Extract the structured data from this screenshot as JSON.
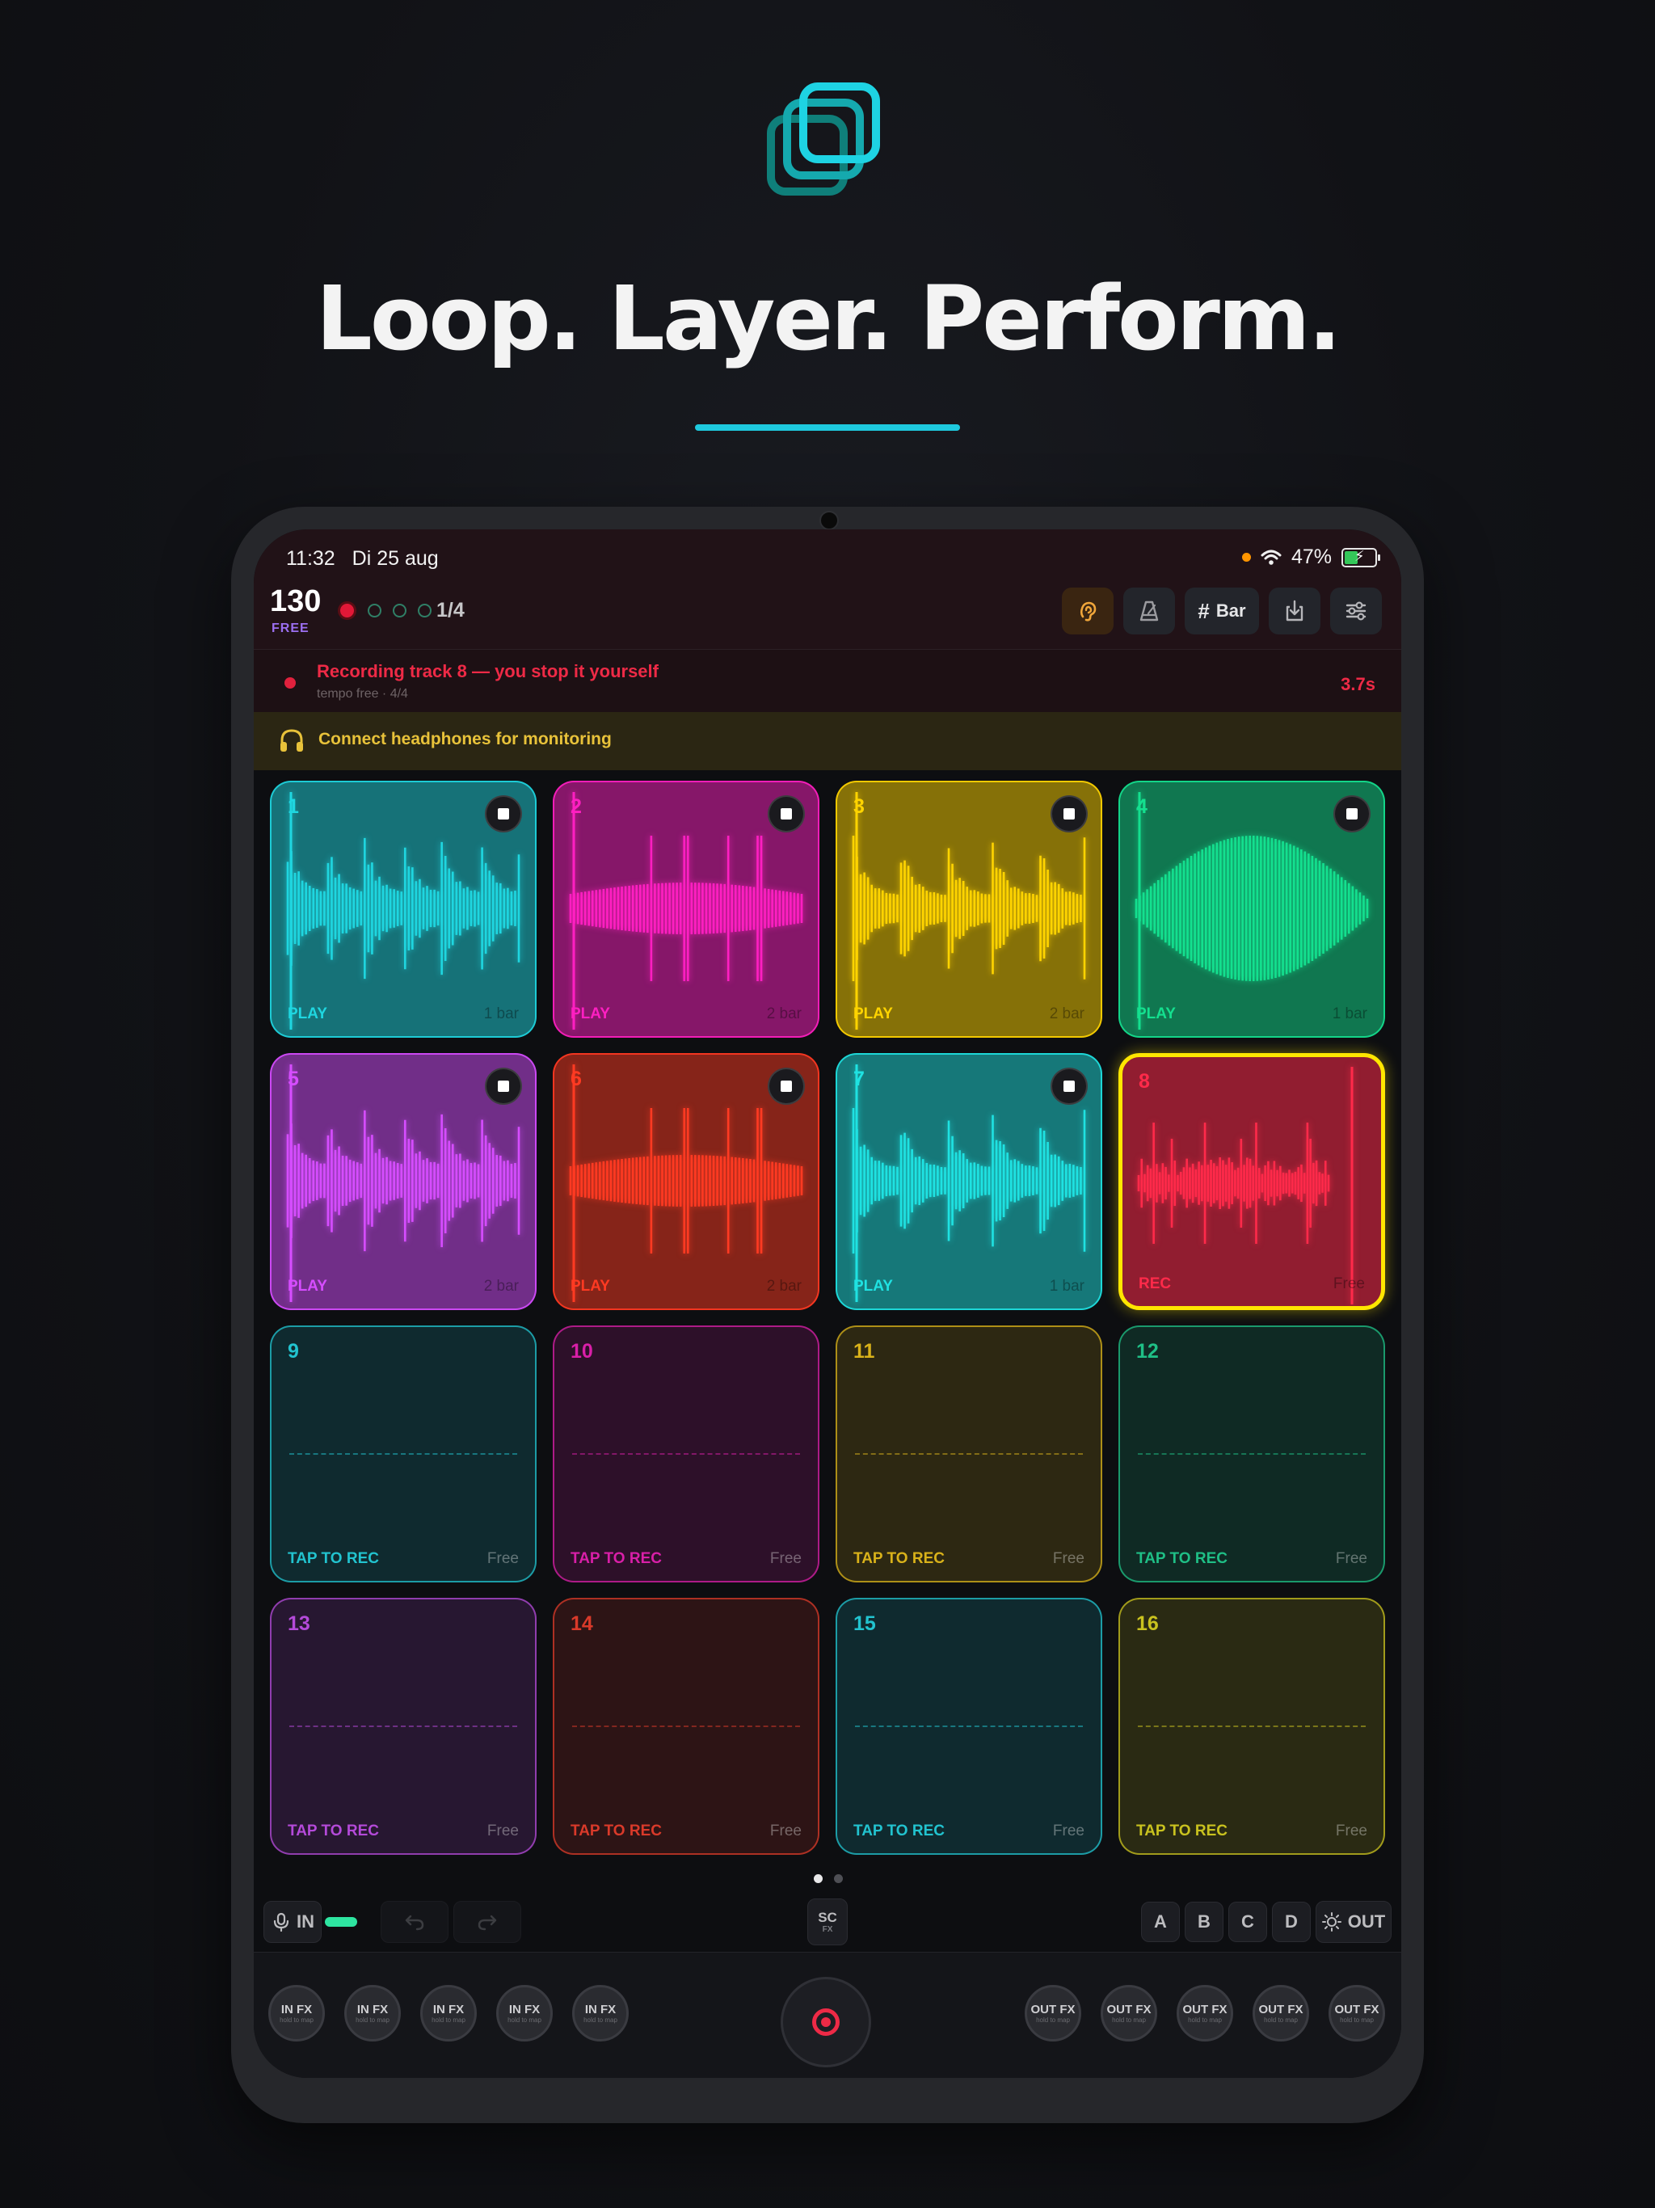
{
  "hero": {
    "headline": "Loop. Layer. Perform.",
    "accent_color": "#1ec9de",
    "logo_icon": "stacked-squares-logo"
  },
  "status_bar": {
    "time": "11:32",
    "date": "Di 25 aug",
    "battery": "47%",
    "icons": [
      "orange-dot",
      "wifi-icon",
      "battery-charging-icon"
    ]
  },
  "toolbar": {
    "bpm": "130",
    "tempo_mode": "FREE",
    "beat_position": "1/4",
    "grid_label": "Bar",
    "icons": [
      "ear-monitor-icon",
      "metronome-icon",
      "grid-icon",
      "import-icon",
      "mixer-settings-icon"
    ]
  },
  "recording_banner": {
    "title": "Recording track 8 — you stop it yourself",
    "subtitle": "tempo free · 4/4",
    "elapsed": "3.7s"
  },
  "headphone_banner": {
    "text": "Connect headphones for monitoring",
    "icon": "headphones-icon"
  },
  "pads": [
    {
      "num": "1",
      "status": "PLAY",
      "length": "1 bar",
      "color": "#1fd6e0",
      "state": "play",
      "wave": "burst"
    },
    {
      "num": "2",
      "status": "PLAY",
      "length": "2 bar",
      "color": "#ff1fc2",
      "state": "play",
      "wave": "swell"
    },
    {
      "num": "3",
      "status": "PLAY",
      "length": "2 bar",
      "color": "#ffd400",
      "state": "play",
      "wave": "decay"
    },
    {
      "num": "4",
      "status": "PLAY",
      "length": "1 bar",
      "color": "#14e08f",
      "state": "play",
      "wave": "sine"
    },
    {
      "num": "5",
      "status": "PLAY",
      "length": "2 bar",
      "color": "#d64dff",
      "state": "play",
      "wave": "burst"
    },
    {
      "num": "6",
      "status": "PLAY",
      "length": "2 bar",
      "color": "#ff3a22",
      "state": "play",
      "wave": "swell"
    },
    {
      "num": "7",
      "status": "PLAY",
      "length": "1 bar",
      "color": "#1fe2e2",
      "state": "play",
      "wave": "decay"
    },
    {
      "num": "8",
      "status": "REC",
      "length": "Free",
      "color": "#ff2a4a",
      "state": "rec",
      "wave": "noise"
    },
    {
      "num": "9",
      "status": "TAP TO REC",
      "length": "Free",
      "color": "#22c3cf",
      "state": "empty"
    },
    {
      "num": "10",
      "status": "TAP TO REC",
      "length": "Free",
      "color": "#d91fa8",
      "state": "empty"
    },
    {
      "num": "11",
      "status": "TAP TO REC",
      "length": "Free",
      "color": "#d9b21a",
      "state": "empty"
    },
    {
      "num": "12",
      "status": "TAP TO REC",
      "length": "Free",
      "color": "#1fbf86",
      "state": "empty"
    },
    {
      "num": "13",
      "status": "TAP TO REC",
      "length": "Free",
      "color": "#b44ad9",
      "state": "empty"
    },
    {
      "num": "14",
      "status": "TAP TO REC",
      "length": "Free",
      "color": "#d93a2a",
      "state": "empty"
    },
    {
      "num": "15",
      "status": "TAP TO REC",
      "length": "Free",
      "color": "#22c3cf",
      "state": "empty"
    },
    {
      "num": "16",
      "status": "TAP TO REC",
      "length": "Free",
      "color": "#c9c21f",
      "state": "empty"
    }
  ],
  "pager": {
    "pages": 2,
    "current": 1
  },
  "controls": {
    "input_label": "IN",
    "sc_label": "SC",
    "sc_sub": "FX",
    "scenes": [
      "A",
      "B",
      "C",
      "D"
    ],
    "output_label": "OUT",
    "icons": [
      "mic-icon",
      "undo-icon",
      "redo-icon",
      "brightness-icon"
    ]
  },
  "fx": {
    "in_knobs": [
      {
        "label": "IN FX",
        "sub": "hold to map"
      },
      {
        "label": "IN FX",
        "sub": "hold to map"
      },
      {
        "label": "IN FX",
        "sub": "hold to map"
      },
      {
        "label": "IN FX",
        "sub": "hold to map"
      },
      {
        "label": "IN FX",
        "sub": "hold to map"
      }
    ],
    "out_knobs": [
      {
        "label": "OUT FX",
        "sub": "hold to map"
      },
      {
        "label": "OUT FX",
        "sub": "hold to map"
      },
      {
        "label": "OUT FX",
        "sub": "hold to map"
      },
      {
        "label": "OUT FX",
        "sub": "hold to map"
      },
      {
        "label": "OUT FX",
        "sub": "hold to map"
      }
    ]
  }
}
